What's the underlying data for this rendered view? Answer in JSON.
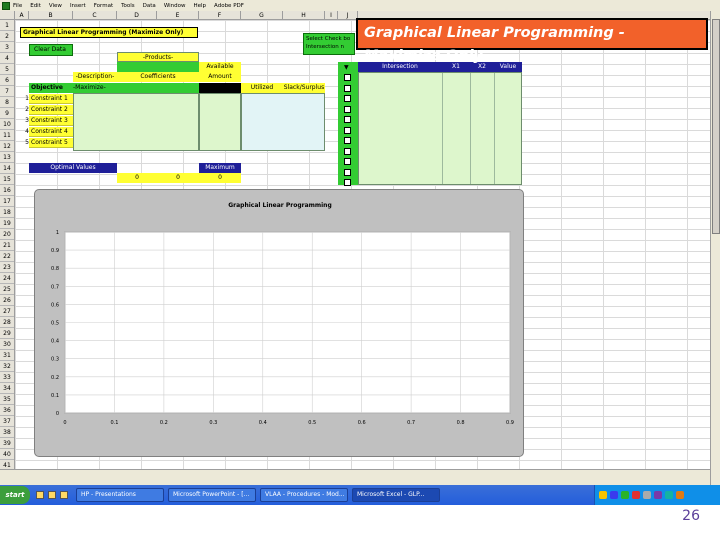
{
  "menubar": {
    "items": [
      "File",
      "Edit",
      "View",
      "Insert",
      "Format",
      "Tools",
      "Data",
      "Window",
      "Help",
      "Adobe PDF"
    ]
  },
  "columns": [
    "A",
    "B",
    "C",
    "D",
    "E",
    "F",
    "G",
    "H",
    "I",
    "J"
  ],
  "rows": [
    "1",
    "2",
    "3",
    "4",
    "5",
    "6",
    "7",
    "8",
    "9",
    "10",
    "11",
    "12",
    "13",
    "14",
    "15",
    "16",
    "17",
    "18",
    "19",
    "20",
    "21",
    "22",
    "23",
    "24",
    "25",
    "26",
    "27",
    "28",
    "29",
    "30",
    "31",
    "32",
    "33",
    "34",
    "35",
    "36",
    "37",
    "38",
    "39",
    "40",
    "41"
  ],
  "sheet": {
    "banner": "Graphical Linear Programming (Maximize Only)",
    "clear_button": "Clear Data",
    "select_button": "Select Check bo Intersection n",
    "products_header": "-Products-",
    "available_header": "Available",
    "amount_header": "Amount",
    "description_header": "-Description-",
    "coefficients_header": "Coefficients",
    "objective_label": "Objective",
    "maximize_label": "-Maximize-",
    "utilized_header": "Utilized",
    "slack_header": "Slack/Surplus",
    "constraints": [
      "Constraint 1",
      "Constraint 2",
      "Constraint 3",
      "Constraint 4",
      "Constraint 5"
    ],
    "constraint_row_numbers": [
      "1",
      "2",
      "3",
      "4",
      "5"
    ],
    "intersection_header": "Intersection",
    "x1_header": "X1",
    "x2_header": "X2",
    "value_header": "Value",
    "checkbox_header": "▼",
    "optimal_values_label": "Optimal Values",
    "maximum_label": "Maximum",
    "optimal_x1": "0",
    "optimal_x2": "0",
    "maximum_value": "0"
  },
  "chart_data": {
    "type": "line",
    "title": "Graphical Linear Programming",
    "xlim": [
      0,
      0.9
    ],
    "ylim": [
      0,
      1
    ],
    "x_ticks": [
      "0",
      "0.1",
      "0.2",
      "0.3",
      "0.4",
      "0.5",
      "0.6",
      "0.7",
      "0.8",
      "0.9"
    ],
    "y_ticks": [
      "0",
      "0.1",
      "0.2",
      "0.3",
      "0.4",
      "0.5",
      "0.6",
      "0.7",
      "0.8",
      "0.9",
      "1"
    ],
    "grid": true,
    "series": []
  },
  "callout": {
    "text": "Graphical Linear Programming - Maximize Only"
  },
  "taskbar": {
    "start_label": "start",
    "tasks": [
      "HP - Presentations",
      "Microsoft PowerPoint - [...",
      "VLAA - Procedures - Mod...",
      "Microsoft Excel - GLP..."
    ],
    "active_task_index": 3
  },
  "slide": {
    "number": "26"
  },
  "colors": {
    "yellow": "#ffff33",
    "green": "#33cc33",
    "light_green": "#ddf6cc",
    "navy": "#1f1f99",
    "callout_orange": "#f2612a",
    "slide_number": "#5b3f99"
  }
}
